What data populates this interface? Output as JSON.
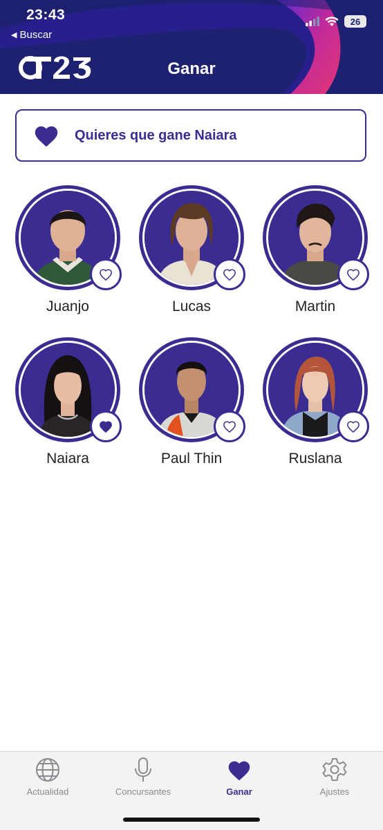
{
  "status_bar": {
    "time": "23:43",
    "back_label": "Buscar",
    "battery": "26"
  },
  "header": {
    "logo_text": "OT23",
    "title": "Ganar"
  },
  "banner": {
    "text": "Quieres que gane Naiara"
  },
  "contestants": [
    {
      "name": "Juanjo",
      "favorite": false
    },
    {
      "name": "Lucas",
      "favorite": false
    },
    {
      "name": "Martin",
      "favorite": false
    },
    {
      "name": "Naiara",
      "favorite": true
    },
    {
      "name": "Paul Thin",
      "favorite": false
    },
    {
      "name": "Ruslana",
      "favorite": false
    }
  ],
  "tabs": [
    {
      "label": "Actualidad",
      "icon": "globe-icon",
      "active": false
    },
    {
      "label": "Concursantes",
      "icon": "microphone-icon",
      "active": false
    },
    {
      "label": "Ganar",
      "icon": "heart-icon",
      "active": true
    },
    {
      "label": "Ajustes",
      "icon": "gear-icon",
      "active": false
    }
  ],
  "colors": {
    "brand": "#3b2c91",
    "header_bg": "#1d2170",
    "swoosh": "#d02d8a"
  }
}
